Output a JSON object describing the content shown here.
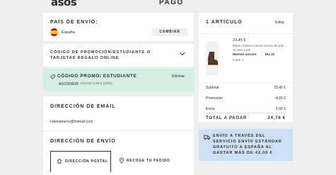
{
  "header": {
    "logo": "asos",
    "title": "PAGO"
  },
  "country": {
    "label": "PAÍS DE ENVÍO:",
    "name": "España",
    "change_button": "CAMBIAR"
  },
  "promo": {
    "label": "CÓDIGO DE PROMOCIÓN/ESTUDIANTE O TARJETAS REGALO ONLINE"
  },
  "applied": {
    "title": "CÓDIGO PROMO/ ESTUDIANTE",
    "remove": "Eliminar",
    "code": "ASOSNEW",
    "saving": "Ahorras 4,69 € (20%)"
  },
  "email": {
    "label": "DIRECCIÓN DE EMAIL",
    "value": "rubenarturoc@hotmail.com"
  },
  "shipping": {
    "label": "DIRECCIÓN DE ENVÍO",
    "option_postal": "DIRECCIÓN POSTAL",
    "option_pickup": "RECOGE TU PEDIDO"
  },
  "bag": {
    "title": "1 ARTÍCULO",
    "edit": "Editar",
    "item": {
      "price": "23,45 €",
      "name": "Botas Chelsea marrón oscuro de ante de New Look",
      "color": "Marrón oscuro",
      "size": "EU 41",
      "qty": "Cant: 1"
    },
    "summary": [
      {
        "label": "Subtotal",
        "value": "23,45 €"
      },
      {
        "label": "Promoción",
        "value": "-4,69 €"
      },
      {
        "label": "Envío",
        "value": "6,00 €"
      }
    ],
    "total_label": "TOTAL A PAGAR",
    "total_value": "24,76 €"
  },
  "banner": {
    "text": "ENVÍO A TRAVÉS DEL SERVICIO ENVÍO ESTÁNDAR GRATUITO A ESPAÑA AL GASTAR MÁS DE 42,00 €"
  },
  "colors": {
    "promo_bg": "#d4eee1",
    "banner_bg": "#cde1f6",
    "page_bg": "#eeeeee"
  }
}
